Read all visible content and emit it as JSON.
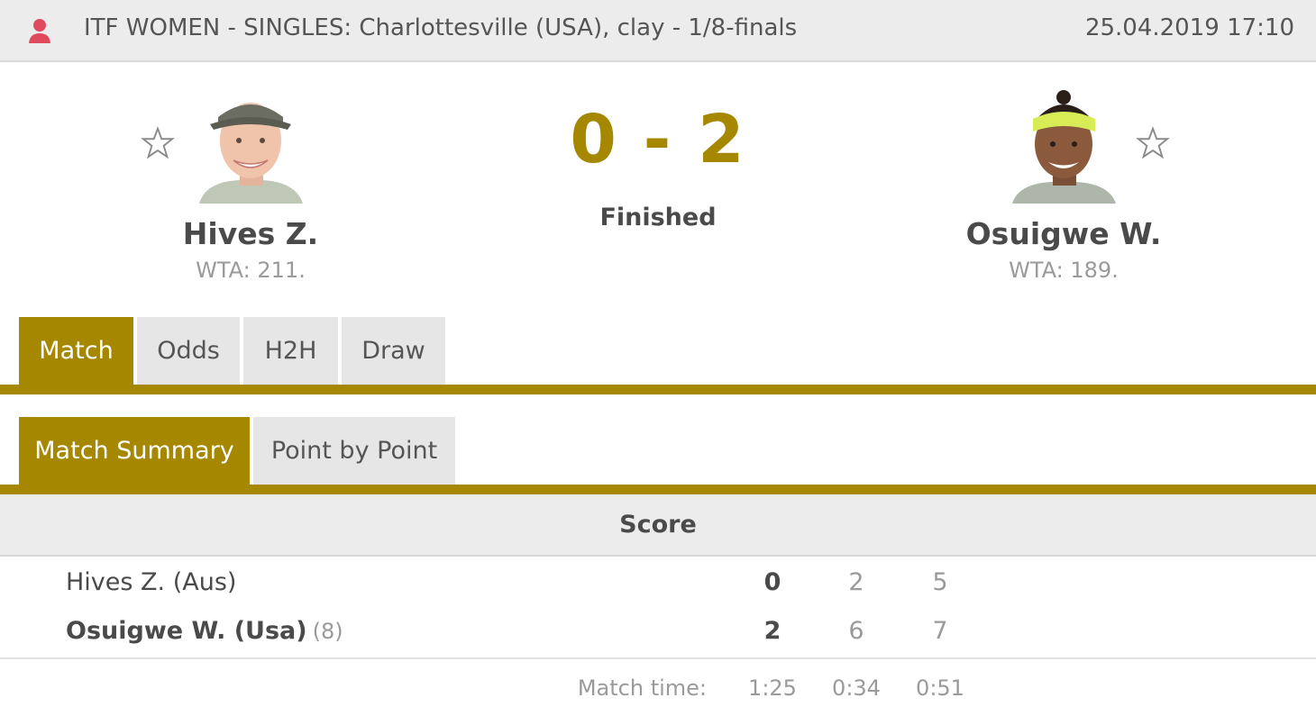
{
  "header": {
    "tournament": "ITF WOMEN - SINGLES: Charlottesville (USA), clay - 1/8-finals",
    "datetime": "25.04.2019 17:10",
    "gender_icon": "female-person-icon"
  },
  "home": {
    "name": "Hives Z.",
    "rank": "WTA: 211.",
    "favorite_icon": "star-outline-icon"
  },
  "away": {
    "name": "Osuigwe W.",
    "rank": "WTA: 189.",
    "favorite_icon": "star-outline-icon"
  },
  "score": {
    "display": "0 - 2",
    "status": "Finished"
  },
  "tabs": [
    {
      "label": "Match",
      "active": true
    },
    {
      "label": "Odds",
      "active": false
    },
    {
      "label": "H2H",
      "active": false
    },
    {
      "label": "Draw",
      "active": false
    }
  ],
  "subtabs": [
    {
      "label": "Match Summary",
      "active": true
    },
    {
      "label": "Point by Point",
      "active": false
    }
  ],
  "summary": {
    "header": "Score",
    "rows": [
      {
        "player": "Hives Z. (Aus)",
        "seed": "",
        "sets": "0",
        "set1": "2",
        "set2": "5"
      },
      {
        "player": "Osuigwe W. (Usa)",
        "seed": "(8)",
        "sets": "2",
        "set1": "6",
        "set2": "7"
      }
    ],
    "time": {
      "label": "Match time:",
      "total": "1:25",
      "set1": "0:34",
      "set2": "0:51"
    }
  },
  "colors": {
    "accent": "#a68700",
    "gender_icon": "#e04a5f"
  }
}
